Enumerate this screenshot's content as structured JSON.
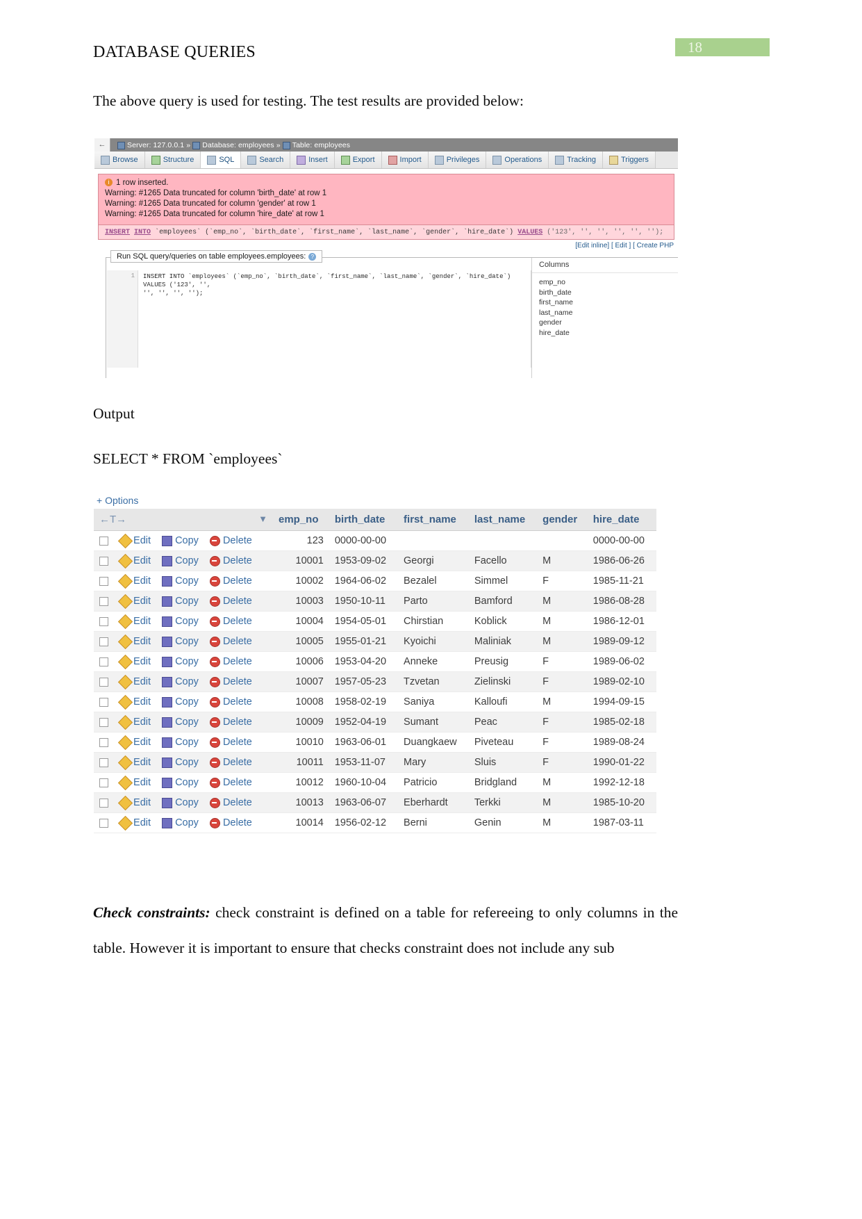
{
  "page": {
    "doc_title": "DATABASE QUERIES",
    "page_number": "18"
  },
  "body": {
    "intro": "The above query is used for testing. The test results are provided below:",
    "output_label": "Output",
    "select_statement": "SELECT * FROM `employees`",
    "check_heading": "Check constraints:",
    "check_text": "  check constraint is defined on a table for refereeing to only columns in the table. However it is important to ensure that checks constraint does not include any sub"
  },
  "phpmyadmin": {
    "back_arrow": "←",
    "breadcrumb": {
      "server": "Server: 127.0.0.1",
      "sep1": "»",
      "database": "Database: employees",
      "sep2": "»",
      "table": "Table: employees"
    },
    "tabs": [
      {
        "label": "Browse",
        "icon": "table-icon",
        "active": false
      },
      {
        "label": "Structure",
        "icon": "structure-icon",
        "active": false
      },
      {
        "label": "SQL",
        "icon": "sql-icon",
        "active": true
      },
      {
        "label": "Search",
        "icon": "search-icon",
        "active": false
      },
      {
        "label": "Insert",
        "icon": "insert-icon",
        "active": false
      },
      {
        "label": "Export",
        "icon": "export-icon",
        "active": false
      },
      {
        "label": "Import",
        "icon": "import-icon",
        "active": false
      },
      {
        "label": "Privileges",
        "icon": "privileges-icon",
        "active": false
      },
      {
        "label": "Operations",
        "icon": "wrench-icon",
        "active": false
      },
      {
        "label": "Tracking",
        "icon": "tracking-icon",
        "active": false
      },
      {
        "label": "Triggers",
        "icon": "triggers-icon",
        "active": false
      }
    ],
    "alert": {
      "headline": "1 row inserted.",
      "warnings": [
        "Warning: #1265 Data truncated for column 'birth_date' at row 1",
        "Warning: #1265 Data truncated for column 'gender' at row 1",
        "Warning: #1265 Data truncated for column 'hire_date' at row 1"
      ]
    },
    "sql_statement": {
      "kw_insert": "INSERT",
      "kw_into": "INTO",
      "table": "`employees`",
      "columns": "(`emp_no`, `birth_date`, `first_name`, `last_name`, `gender`, `hire_date`)",
      "kw_values": "VALUES",
      "values": "('123', '', '', '', '', '');"
    },
    "edit_links": "[Edit inline] [ Edit ] [ Create PHP",
    "run_panel": {
      "title": "Run SQL query/queries on table employees.employees:",
      "help_icon": "?",
      "line_number": "1",
      "editor_line1": "INSERT INTO `employees` (`emp_no`, `birth_date`, `first_name`, `last_name`, `gender`, `hire_date`) VALUES ('123', '',",
      "editor_line2": "'', '', '', '');"
    },
    "columns_panel": {
      "title": "Columns",
      "items": [
        "emp_no",
        "birth_date",
        "first_name",
        "last_name",
        "gender",
        "hire_date"
      ]
    }
  },
  "results": {
    "options_label": "+ Options",
    "sort_controls": "←T→",
    "sort_arrow": "▼",
    "headers": [
      "emp_no",
      "birth_date",
      "first_name",
      "last_name",
      "gender",
      "hire_date"
    ],
    "actions": {
      "edit": "Edit",
      "copy": "Copy",
      "delete": "Delete"
    },
    "rows": [
      {
        "emp_no": "123",
        "birth_date": "0000-00-00",
        "first_name": "",
        "last_name": "",
        "gender": "",
        "hire_date": "0000-00-00"
      },
      {
        "emp_no": "10001",
        "birth_date": "1953-09-02",
        "first_name": "Georgi",
        "last_name": "Facello",
        "gender": "M",
        "hire_date": "1986-06-26"
      },
      {
        "emp_no": "10002",
        "birth_date": "1964-06-02",
        "first_name": "Bezalel",
        "last_name": "Simmel",
        "gender": "F",
        "hire_date": "1985-11-21"
      },
      {
        "emp_no": "10003",
        "birth_date": "1950-10-11",
        "first_name": "Parto",
        "last_name": "Bamford",
        "gender": "M",
        "hire_date": "1986-08-28"
      },
      {
        "emp_no": "10004",
        "birth_date": "1954-05-01",
        "first_name": "Chirstian",
        "last_name": "Koblick",
        "gender": "M",
        "hire_date": "1986-12-01"
      },
      {
        "emp_no": "10005",
        "birth_date": "1955-01-21",
        "first_name": "Kyoichi",
        "last_name": "Maliniak",
        "gender": "M",
        "hire_date": "1989-09-12"
      },
      {
        "emp_no": "10006",
        "birth_date": "1953-04-20",
        "first_name": "Anneke",
        "last_name": "Preusig",
        "gender": "F",
        "hire_date": "1989-06-02"
      },
      {
        "emp_no": "10007",
        "birth_date": "1957-05-23",
        "first_name": "Tzvetan",
        "last_name": "Zielinski",
        "gender": "F",
        "hire_date": "1989-02-10"
      },
      {
        "emp_no": "10008",
        "birth_date": "1958-02-19",
        "first_name": "Saniya",
        "last_name": "Kalloufi",
        "gender": "M",
        "hire_date": "1994-09-15"
      },
      {
        "emp_no": "10009",
        "birth_date": "1952-04-19",
        "first_name": "Sumant",
        "last_name": "Peac",
        "gender": "F",
        "hire_date": "1985-02-18"
      },
      {
        "emp_no": "10010",
        "birth_date": "1963-06-01",
        "first_name": "Duangkaew",
        "last_name": "Piveteau",
        "gender": "F",
        "hire_date": "1989-08-24"
      },
      {
        "emp_no": "10011",
        "birth_date": "1953-11-07",
        "first_name": "Mary",
        "last_name": "Sluis",
        "gender": "F",
        "hire_date": "1990-01-22"
      },
      {
        "emp_no": "10012",
        "birth_date": "1960-10-04",
        "first_name": "Patricio",
        "last_name": "Bridgland",
        "gender": "M",
        "hire_date": "1992-12-18"
      },
      {
        "emp_no": "10013",
        "birth_date": "1963-06-07",
        "first_name": "Eberhardt",
        "last_name": "Terkki",
        "gender": "M",
        "hire_date": "1985-10-20"
      },
      {
        "emp_no": "10014",
        "birth_date": "1956-02-12",
        "first_name": "Berni",
        "last_name": "Genin",
        "gender": "M",
        "hire_date": "1987-03-11"
      }
    ]
  },
  "colors": {
    "page_badge_bg": "#a9d18e",
    "alert_bg": "#ffb6c1",
    "link_blue": "#3a6ea5",
    "header_gray": "#e7e7e7"
  }
}
